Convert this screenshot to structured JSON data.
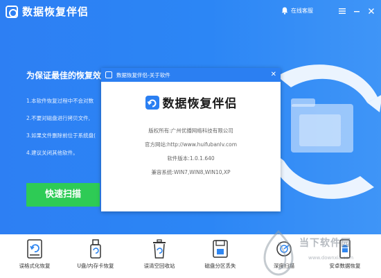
{
  "app": {
    "title": "数据恢复伴侣",
    "online_service": "在线客服"
  },
  "main": {
    "headline": "为保证最佳的恢复效果",
    "tips": [
      "1.本软件恢复过程中不会对数",
      "2.不要对磁盘进行拷贝文件,",
      "3.如果文件删除前位于系统盘(",
      "4.建议关闭其他软件。"
    ],
    "scan_button": "快速扫描"
  },
  "dialog": {
    "title": "数据恢复伴侣-关于软件",
    "brand": "数据恢复伴侣",
    "copyright": "版权所有:广州优播网络科技有限公司",
    "website": "官方网站:http://www.huifubanlv.com",
    "version": "软件版本:1.0.1.640",
    "compat": "兼容系统:WIN7,WIN8,WIN10,XP"
  },
  "tools": [
    {
      "label": "误格式化恢复",
      "icon": "drive-restore-icon"
    },
    {
      "label": "U盘/内存卡恢复",
      "icon": "usb-drive-icon"
    },
    {
      "label": "误清空回收站",
      "icon": "recycle-bin-icon"
    },
    {
      "label": "磁盘分区丢失",
      "icon": "disk-partition-icon"
    },
    {
      "label": "深度扫描",
      "icon": "deep-scan-icon"
    },
    {
      "label": "安卓数据恢复",
      "icon": "android-icon"
    }
  ],
  "watermark": {
    "name": "当下软件园",
    "url": "www.downxia.com"
  },
  "colors": {
    "primary": "#2b7ff2",
    "scan_button": "#2ecb55",
    "icon_accent": "#2f86f0"
  }
}
